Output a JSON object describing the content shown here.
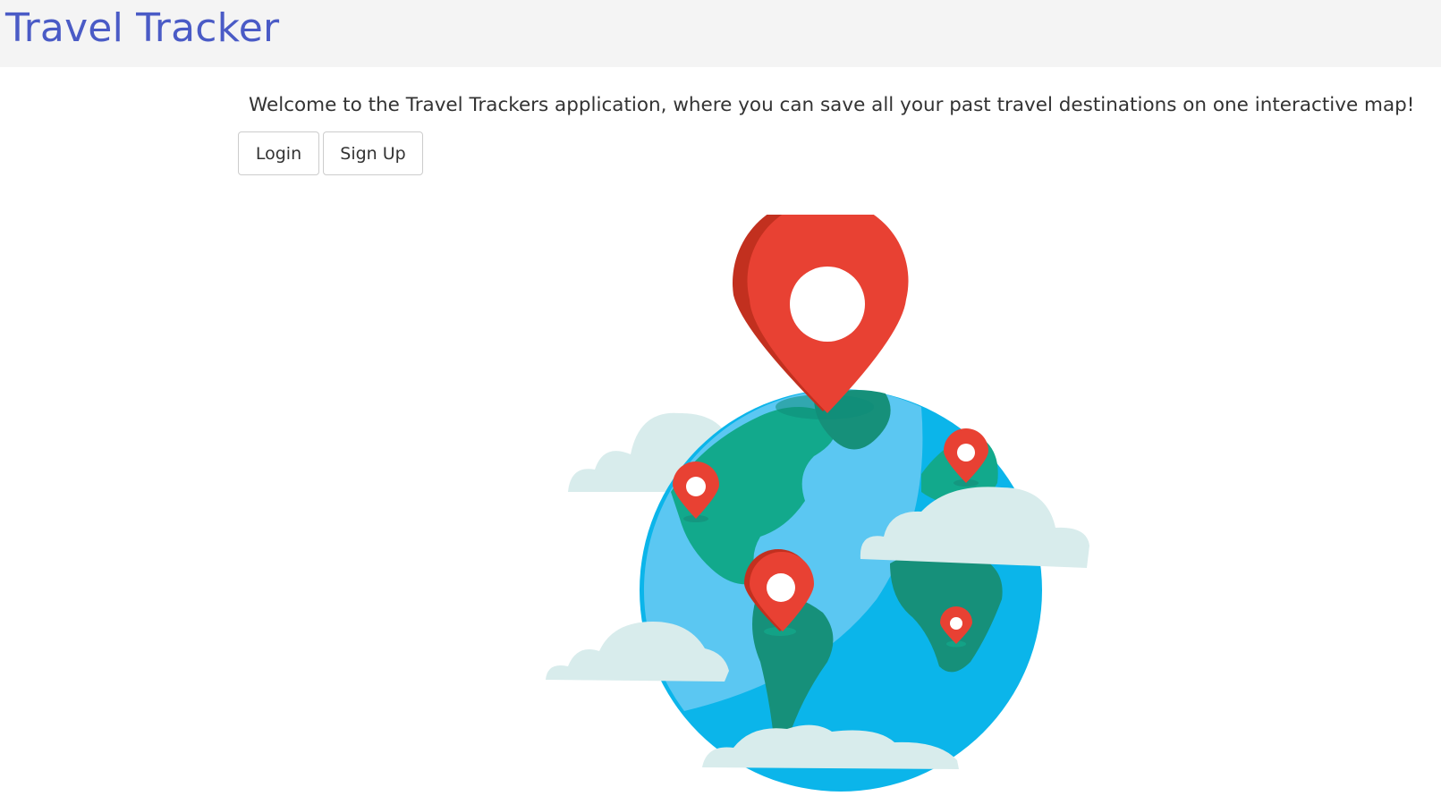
{
  "navbar": {
    "brand": "Travel Tracker"
  },
  "main": {
    "welcome_text": "Welcome to the Travel Trackers application, where you can save all your past travel destinations on one interactive map!",
    "login_label": "Login",
    "signup_label": "Sign Up"
  },
  "illustration": {
    "icon": "globe-with-location-pins",
    "colors": {
      "ocean_dark": "#0bb5ea",
      "ocean_light": "#5bc7f2",
      "land": "#12a98c",
      "land_shade": "#16907a",
      "pin": "#e84133",
      "pin_shadow": "#c2301f",
      "cloud": "#d8ecec"
    }
  }
}
